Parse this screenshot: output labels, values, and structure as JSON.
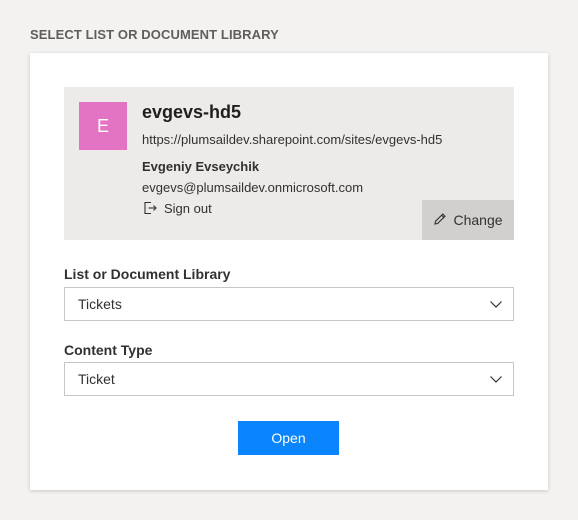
{
  "page": {
    "section_title": "SELECT LIST OR DOCUMENT LIBRARY"
  },
  "site": {
    "avatar_letter": "E",
    "avatar_color": "#e373c3",
    "name": "evgevs-hd5",
    "url": "https://plumsaildev.sharepoint.com/sites/evgevs-hd5"
  },
  "user": {
    "name": "Evgeniy Evseychik",
    "email": "evgevs@plumsaildev.onmicrosoft.com",
    "sign_out_label": "Sign out",
    "sign_out_icon": "sign-out-icon"
  },
  "change": {
    "label": "Change",
    "icon": "pencil-icon"
  },
  "list_field": {
    "label": "List or Document Library",
    "value": "Tickets",
    "icon": "chevron-down-icon"
  },
  "content_type_field": {
    "label": "Content Type",
    "value": "Ticket",
    "icon": "chevron-down-icon"
  },
  "open_button": {
    "label": "Open",
    "color": "#0a84ff"
  }
}
